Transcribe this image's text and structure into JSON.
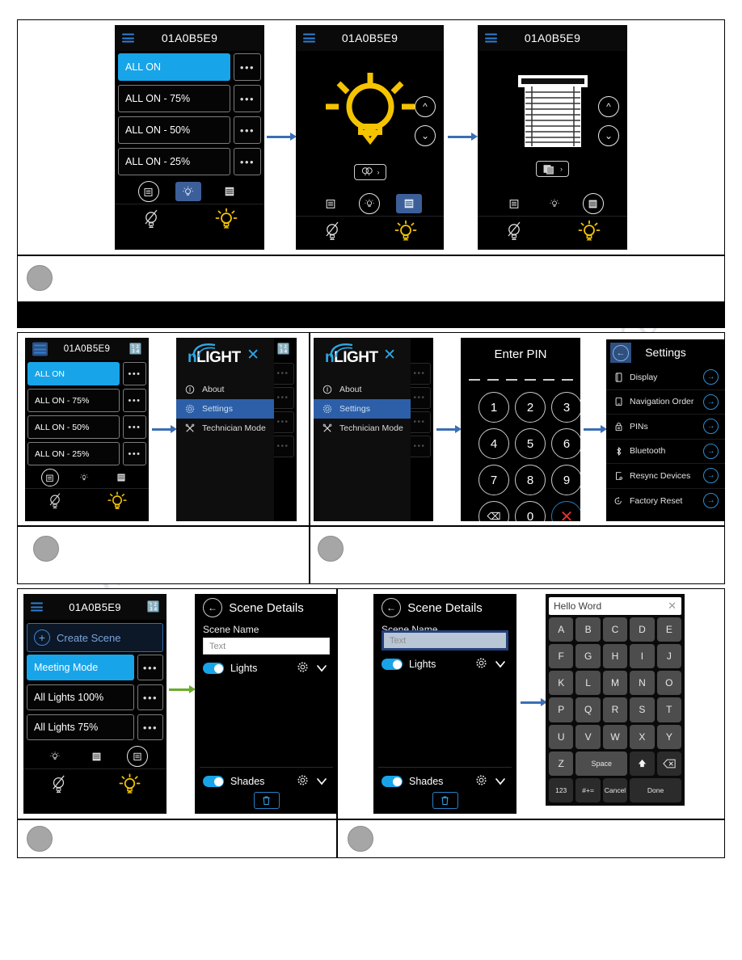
{
  "device_id": "01A0B5E9",
  "watermark": "manualshive.com",
  "scene_list": {
    "create_scene_label": "Create Scene",
    "rows_a": [
      "ALL ON",
      "ALL ON - 75%",
      "ALL ON - 50%",
      "ALL ON - 25%"
    ],
    "rows_c": [
      "Meeting Mode",
      "All Lights 100%",
      "All Lights 75%"
    ],
    "dots_label": "•••"
  },
  "menu": {
    "brand_n": "n",
    "brand_light": "LIGHT",
    "close_label": "✕",
    "items": [
      {
        "label": "About",
        "icon": "info-icon"
      },
      {
        "label": "Settings",
        "icon": "gear-icon"
      },
      {
        "label": "Technician Mode",
        "icon": "tools-icon"
      }
    ]
  },
  "pin": {
    "title": "Enter PIN",
    "keys": [
      "1",
      "2",
      "3",
      "4",
      "5",
      "6",
      "7",
      "8",
      "9"
    ],
    "zero": "0",
    "backspace_label": "⌫",
    "cancel_label": "✕",
    "dash_count": 6
  },
  "settings": {
    "title": "Settings",
    "back_label": "←",
    "rows": [
      {
        "label": "Display",
        "icon": "display-icon",
        "go": "→"
      },
      {
        "label": "Navigation Order",
        "icon": "phone-icon",
        "go": "→"
      },
      {
        "label": "PINs",
        "icon": "lock-icon",
        "go": "→"
      },
      {
        "label": "Bluetooth",
        "icon": "bluetooth-icon",
        "go": "→"
      },
      {
        "label": "Resync Devices",
        "icon": "resync-icon",
        "go": "→"
      },
      {
        "label": "Factory Reset",
        "icon": "reset-icon",
        "go": "→"
      }
    ]
  },
  "scene_details": {
    "title": "Scene Details",
    "back_label": "←",
    "name_label": "Scene Name",
    "name_placeholder": "Text",
    "lights_label": "Lights",
    "shades_label": "Shades",
    "gear_label": "⚙",
    "chevron_label": "⌄",
    "trash_label": "Ὕ1"
  },
  "keyboard": {
    "field_value": "Hello Word",
    "clear_label": "✕",
    "rows": [
      [
        "A",
        "B",
        "C",
        "D",
        "E"
      ],
      [
        "F",
        "G",
        "H",
        "I",
        "J"
      ],
      [
        "K",
        "L",
        "M",
        "N",
        "O"
      ],
      [
        "P",
        "Q",
        "R",
        "S",
        "T"
      ],
      [
        "U",
        "V",
        "W",
        "X",
        "Y"
      ]
    ],
    "z_label": "Z",
    "space_label": "Space",
    "shift_label": "⬆",
    "backspace_label": "⌫",
    "num_label": "123",
    "sym_label": "#+=",
    "cancel_label": "Cancel",
    "done_label": "Done"
  },
  "colors": {
    "accent_blue": "#18a4e8",
    "menu_blue": "#2c5fa8",
    "lamp_yellow": "#f5c400",
    "arrow_blue": "#3b6eb5",
    "arrow_green": "#6aab2a",
    "bullet_gray": "#a6a6a6"
  }
}
